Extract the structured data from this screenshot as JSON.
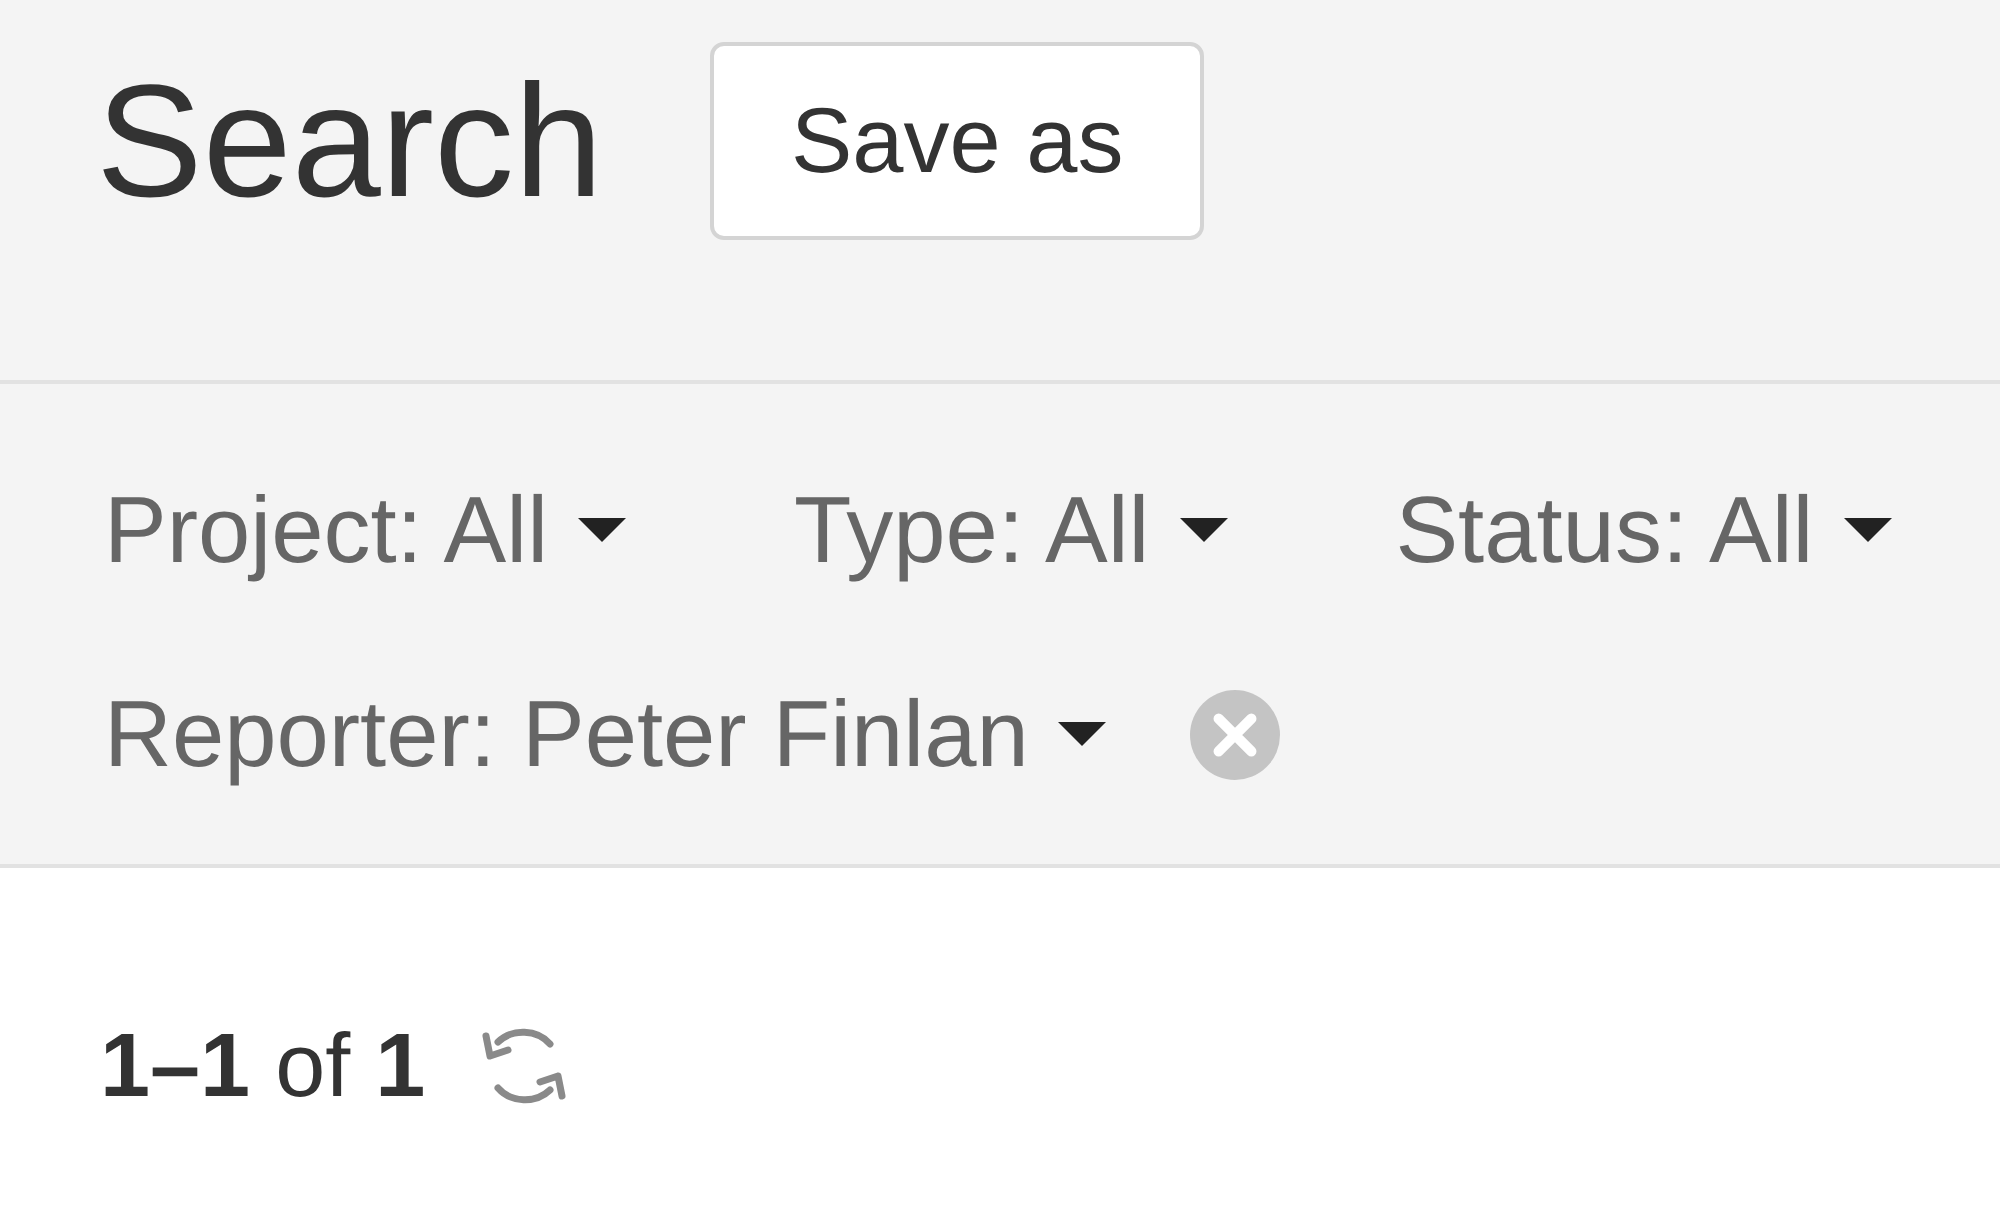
{
  "header": {
    "title": "Search",
    "save_button": "Save as"
  },
  "filters": [
    {
      "label": "Project: All",
      "removable": false
    },
    {
      "label": "Type: All",
      "removable": false
    },
    {
      "label": "Status: All",
      "removable": false
    },
    {
      "label": "Reporter: Peter Finlan",
      "removable": true
    }
  ],
  "results": {
    "count": "**1–1** of **1**"
  }
}
